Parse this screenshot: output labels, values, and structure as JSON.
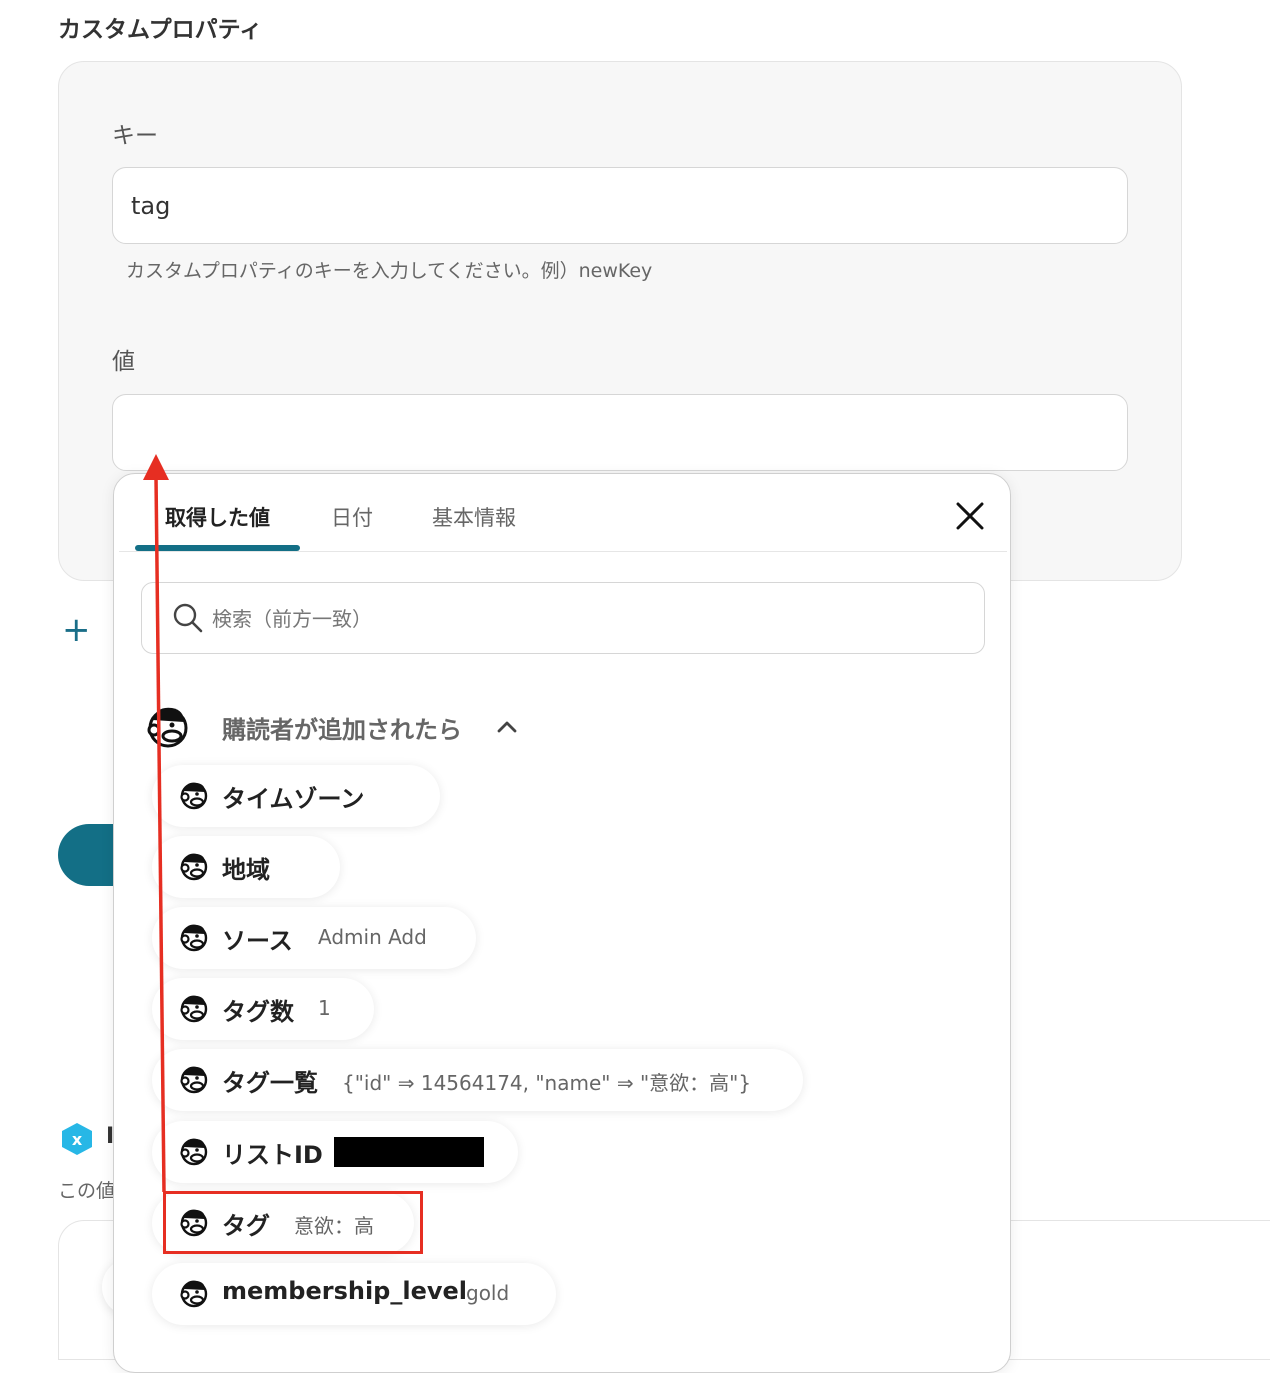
{
  "section_title": "カスタムプロパティ",
  "key_field": {
    "label": "キー",
    "value": "tag",
    "hint": "カスタムプロパティのキーを入力してください。例）newKey"
  },
  "value_field": {
    "label": "値",
    "value": ""
  },
  "add_icon": "+",
  "partial_bg": {
    "title_char": "I",
    "text": "この値"
  },
  "popup": {
    "tabs": [
      {
        "label": "取得した値",
        "active": true
      },
      {
        "label": "日付",
        "active": false
      },
      {
        "label": "基本情報",
        "active": false
      }
    ],
    "search": {
      "placeholder": "検索（前方一致）"
    },
    "group": {
      "title": "購読者が追加されたら",
      "icon": "mailchimp-icon",
      "expanded": true
    },
    "items": [
      {
        "name": "タイムゾーン",
        "value": ""
      },
      {
        "name": "地域",
        "value": ""
      },
      {
        "name": "ソース",
        "value": "Admin Add"
      },
      {
        "name": "タグ数",
        "value": "1"
      },
      {
        "name": "タグ一覧",
        "value": "{\"id\" ⇒ 14564174, \"name\" ⇒ \"意欲：高\"}"
      },
      {
        "name": "リストID",
        "value": "",
        "redacted": true
      },
      {
        "name": "タグ",
        "value": "意欲：高",
        "highlighted": true
      },
      {
        "name": "membership_level",
        "value": "gold"
      }
    ]
  },
  "colors": {
    "accent": "#136f86",
    "highlight": "#e62e22",
    "card_bg": "#f7f7f7"
  }
}
